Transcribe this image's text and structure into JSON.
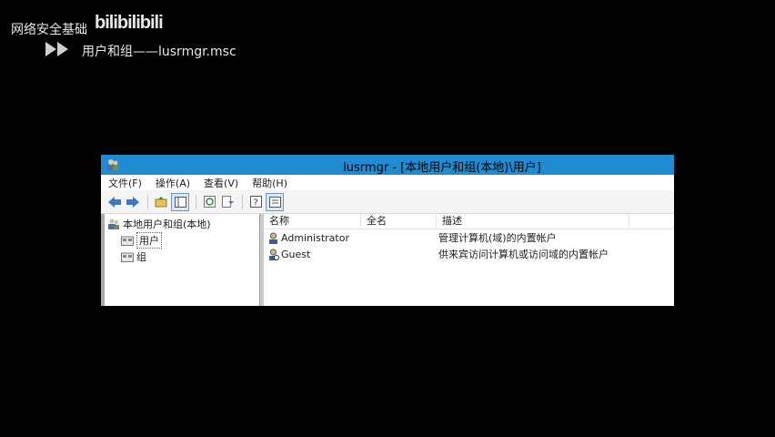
{
  "overlay": {
    "channel_title": "网络安全基础",
    "logo_text": "bilibilibili",
    "subtitle": "用户和组——lusrmgr.msc"
  },
  "window": {
    "title": "lusrmgr - [本地用户和组(本地)\\用户]",
    "menu": [
      "文件(F)",
      "操作(A)",
      "查看(V)",
      "帮助(H)"
    ],
    "toolbar": [
      "back-icon",
      "forward-icon",
      "up-folder-icon",
      "show-tree-icon",
      "refresh-icon",
      "export-icon",
      "help-icon",
      "properties-icon"
    ],
    "tree": {
      "root": "本地用户和组(本地)",
      "children": [
        "用户",
        "组"
      ],
      "selected": "用户"
    },
    "list": {
      "columns": [
        "名称",
        "全名",
        "描述"
      ],
      "rows": [
        {
          "name": "Administrator",
          "fullname": "",
          "description": "管理计算机(域)的内置帐户"
        },
        {
          "name": "Guest",
          "fullname": "",
          "description": "供来宾访问计算机或访问域的内置帐户"
        }
      ]
    }
  }
}
